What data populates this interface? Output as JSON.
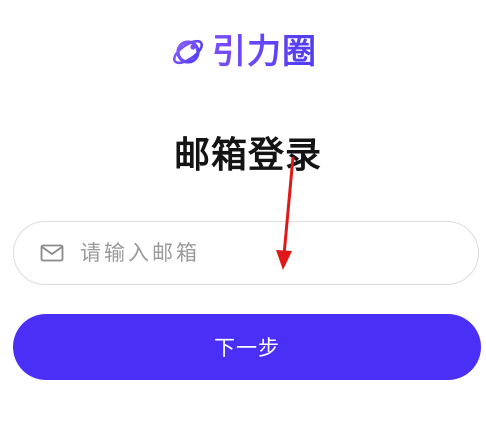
{
  "logo": {
    "text": "引力圈",
    "icon": "orbit-logo-icon",
    "color": "#5b3df5"
  },
  "title": "邮箱登录",
  "email": {
    "placeholder": "请输入邮箱",
    "value": "",
    "icon": "mail-icon"
  },
  "next_button": {
    "label": "下一步",
    "color": "#4a30f6"
  },
  "annotation": {
    "icon": "red-arrow-annotation",
    "color": "#e01818"
  }
}
